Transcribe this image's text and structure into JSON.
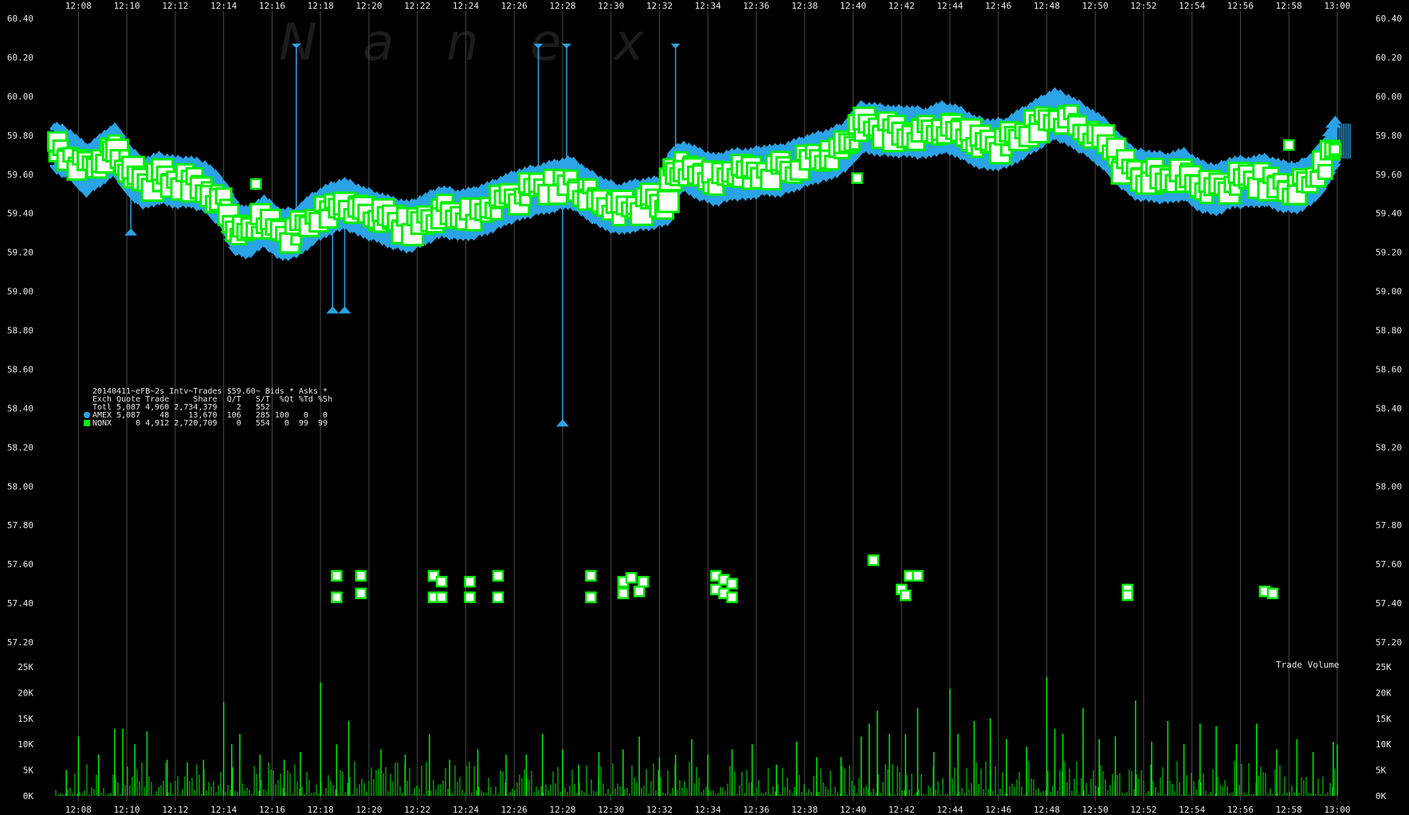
{
  "chart_data": {
    "type": "scatter",
    "title": "20140411~eFB~2s Intv~Trades $59.60~ Bids * Asks *",
    "watermark": [
      "N",
      "a",
      "n",
      "e",
      "x"
    ],
    "x_ticks": [
      "12:08",
      "12:10",
      "12:12",
      "12:14",
      "12:16",
      "12:18",
      "12:20",
      "12:22",
      "12:24",
      "12:26",
      "12:28",
      "12:30",
      "12:32",
      "12:34",
      "12:36",
      "12:38",
      "12:40",
      "12:42",
      "12:44",
      "12:46",
      "12:48",
      "12:50",
      "12:52",
      "12:54",
      "12:56",
      "12:58",
      "13:00"
    ],
    "xlim": [
      "12:07",
      "13:00"
    ],
    "price_axis": {
      "ticks": [
        "57.20",
        "57.40",
        "57.60",
        "57.80",
        "58.00",
        "58.20",
        "58.40",
        "58.60",
        "58.80",
        "59.00",
        "59.20",
        "59.40",
        "59.60",
        "59.80",
        "60.00",
        "60.20",
        "60.40"
      ],
      "ylim": [
        57.2,
        60.4
      ]
    },
    "volume_axis": {
      "label": "Trade Volume",
      "ticks": [
        "0K",
        "5K",
        "10K",
        "15K",
        "20K",
        "25K"
      ],
      "ylim": [
        0,
        25000
      ]
    },
    "grid": true,
    "legend": {
      "placement": "left-middle",
      "header": "Exch Quote Trade     Share  Q/T   S/T  %Qt %Td %Sh",
      "total": "Totl 5,087 4,960 2,734,379    2   552",
      "rows": [
        {
          "marker": "circle",
          "color": "#2aa4e6",
          "text": "AMEX 5,087    48    13,670  106   285 100   0   0"
        },
        {
          "marker": "square",
          "color": "#00ee00",
          "text": "NQNX     0 4,912 2,720,709    0   554   0  99  99"
        }
      ]
    },
    "series": [
      {
        "name": "AMEX",
        "color": "#2aa4e6",
        "quote_band": {
          "x": [
            "12:07:00",
            "12:07:40",
            "12:08:20",
            "12:09:00",
            "12:09:30",
            "12:10:00",
            "12:10:40",
            "12:11:20",
            "12:12:00",
            "12:12:40",
            "12:13:20",
            "12:14:00",
            "12:14:30",
            "12:15:00",
            "12:15:40",
            "12:16:20",
            "12:17:00",
            "12:17:40",
            "12:18:20",
            "12:19:00",
            "12:19:40",
            "12:20:20",
            "12:21:00",
            "12:21:40",
            "12:22:20",
            "12:23:00",
            "12:23:40",
            "12:24:20",
            "12:25:00",
            "12:25:40",
            "12:26:20",
            "12:27:00",
            "12:27:40",
            "12:28:20",
            "12:29:00",
            "12:29:40",
            "12:30:20",
            "12:31:00",
            "12:31:40",
            "12:32:20",
            "12:32:30",
            "12:33:00",
            "12:33:40",
            "12:34:20",
            "12:35:00",
            "12:35:40",
            "12:36:20",
            "12:37:00",
            "12:37:40",
            "12:38:20",
            "12:39:00",
            "12:39:40",
            "12:40:20",
            "12:41:00",
            "12:41:40",
            "12:42:20",
            "12:43:00",
            "12:43:40",
            "12:44:20",
            "12:45:00",
            "12:45:40",
            "12:46:20",
            "12:47:00",
            "12:47:40",
            "12:48:20",
            "12:49:00",
            "12:49:40",
            "12:50:20",
            "12:51:00",
            "12:51:40",
            "12:52:20",
            "12:53:00",
            "12:53:40",
            "12:54:20",
            "12:55:00",
            "12:55:40",
            "12:56:20",
            "12:57:00",
            "12:57:40",
            "12:58:20",
            "12:59:00",
            "12:59:30",
            "13:00:00"
          ],
          "mid": [
            59.74,
            59.7,
            59.62,
            59.68,
            59.73,
            59.63,
            59.55,
            59.58,
            59.56,
            59.56,
            59.53,
            59.44,
            59.32,
            59.3,
            59.36,
            59.29,
            59.3,
            59.37,
            59.42,
            59.45,
            59.41,
            59.38,
            59.35,
            59.33,
            59.37,
            59.41,
            59.39,
            59.4,
            59.43,
            59.47,
            59.5,
            59.52,
            59.54,
            59.56,
            59.5,
            59.45,
            59.42,
            59.44,
            59.45,
            59.47,
            59.6,
            59.64,
            59.6,
            59.57,
            59.6,
            59.6,
            59.62,
            59.62,
            59.65,
            59.68,
            59.7,
            59.74,
            59.84,
            59.83,
            59.82,
            59.82,
            59.81,
            59.84,
            59.82,
            59.77,
            59.75,
            59.76,
            59.81,
            59.86,
            59.91,
            59.87,
            59.82,
            59.76,
            59.67,
            59.6,
            59.59,
            59.58,
            59.6,
            59.54,
            59.52,
            59.56,
            59.56,
            59.57,
            59.54,
            59.53,
            59.58,
            59.66,
            59.79
          ],
          "half_width": 0.1
        },
        "spikes": [
          {
            "x": "12:17:00",
            "from": 59.42,
            "to": 60.27
          },
          {
            "x": "12:10:10",
            "from": 59.48,
            "to": 59.29
          },
          {
            "x": "12:18:30",
            "from": 59.36,
            "to": 58.89
          },
          {
            "x": "12:19:00",
            "from": 59.36,
            "to": 58.89
          },
          {
            "x": "12:27:00",
            "from": 59.62,
            "to": 60.27
          },
          {
            "x": "12:28:10",
            "from": 59.68,
            "to": 60.27
          },
          {
            "x": "12:28:00",
            "from": 59.5,
            "to": 58.31
          },
          {
            "x": "12:32:40",
            "from": 59.7,
            "to": 60.27
          }
        ]
      },
      {
        "name": "NQNX",
        "color": "#00ee00",
        "outliers": [
          {
            "x": "12:18:40",
            "y": 57.54
          },
          {
            "x": "12:18:40",
            "y": 57.43
          },
          {
            "x": "12:19:40",
            "y": 57.54
          },
          {
            "x": "12:19:40",
            "y": 57.45
          },
          {
            "x": "12:22:40",
            "y": 57.54
          },
          {
            "x": "12:23:00",
            "y": 57.51
          },
          {
            "x": "12:22:40",
            "y": 57.43
          },
          {
            "x": "12:23:00",
            "y": 57.43
          },
          {
            "x": "12:24:10",
            "y": 57.51
          },
          {
            "x": "12:24:10",
            "y": 57.43
          },
          {
            "x": "12:25:20",
            "y": 57.54
          },
          {
            "x": "12:25:20",
            "y": 57.43
          },
          {
            "x": "12:29:10",
            "y": 57.54
          },
          {
            "x": "12:29:10",
            "y": 57.43
          },
          {
            "x": "12:30:30",
            "y": 57.51
          },
          {
            "x": "12:30:50",
            "y": 57.53
          },
          {
            "x": "12:31:20",
            "y": 57.51
          },
          {
            "x": "12:30:30",
            "y": 57.45
          },
          {
            "x": "12:31:10",
            "y": 57.46
          },
          {
            "x": "12:34:20",
            "y": 57.54
          },
          {
            "x": "12:34:40",
            "y": 57.52
          },
          {
            "x": "12:35:00",
            "y": 57.5
          },
          {
            "x": "12:34:20",
            "y": 57.47
          },
          {
            "x": "12:34:40",
            "y": 57.45
          },
          {
            "x": "12:35:00",
            "y": 57.43
          },
          {
            "x": "12:40:50",
            "y": 57.62
          },
          {
            "x": "12:42:20",
            "y": 57.54
          },
          {
            "x": "12:42:40",
            "y": 57.54
          },
          {
            "x": "12:42:00",
            "y": 57.47
          },
          {
            "x": "12:42:10",
            "y": 57.44
          },
          {
            "x": "12:51:20",
            "y": 57.47
          },
          {
            "x": "12:51:20",
            "y": 57.44
          },
          {
            "x": "12:57:00",
            "y": 57.46
          },
          {
            "x": "12:57:20",
            "y": 57.45
          }
        ],
        "isolated": [
          {
            "x": "12:15:20",
            "y": 59.55
          },
          {
            "x": "12:40:10",
            "y": 59.58
          },
          {
            "x": "12:58:00",
            "y": 59.75
          }
        ]
      }
    ],
    "volume_series": {
      "name": "Trade Volume",
      "color": "#00ee00",
      "x": [
        "12:07:30",
        "12:08:00",
        "12:08:50",
        "12:09:30",
        "12:09:50",
        "12:10:20",
        "12:10:50",
        "12:11:40",
        "12:12:30",
        "12:13:10",
        "12:14:00",
        "12:14:20",
        "12:14:40",
        "12:15:30",
        "12:16:30",
        "12:17:10",
        "12:18:00",
        "12:18:40",
        "12:19:10",
        "12:20:30",
        "12:21:30",
        "12:22:30",
        "12:23:20",
        "12:24:30",
        "12:25:40",
        "12:26:30",
        "12:27:10",
        "12:28:00",
        "12:28:40",
        "12:29:30",
        "12:30:30",
        "12:31:10",
        "12:32:00",
        "12:32:40",
        "12:33:20",
        "12:34:00",
        "12:35:00",
        "12:35:50",
        "12:36:50",
        "12:37:40",
        "12:38:30",
        "12:39:30",
        "12:40:20",
        "12:40:40",
        "12:41:00",
        "12:41:30",
        "12:42:10",
        "12:42:40",
        "12:43:20",
        "12:44:00",
        "12:44:20",
        "12:45:00",
        "12:45:40",
        "12:46:20",
        "12:47:10",
        "12:48:00",
        "12:48:20",
        "12:48:40",
        "12:49:30",
        "12:50:10",
        "12:50:50",
        "12:51:40",
        "12:52:20",
        "12:53:00",
        "12:53:40",
        "12:54:20",
        "12:55:00",
        "12:55:50",
        "12:56:40",
        "12:57:30",
        "12:58:20",
        "12:59:00",
        "12:59:50",
        "13:00:00"
      ],
      "values": [
        5000,
        11500,
        8000,
        13000,
        13000,
        10000,
        12500,
        7000,
        6500,
        7000,
        18200,
        10000,
        12000,
        8000,
        7000,
        8500,
        22000,
        10000,
        14500,
        9000,
        8000,
        12000,
        7000,
        9000,
        8000,
        8000,
        12000,
        9000,
        6000,
        8500,
        9000,
        11500,
        7500,
        8000,
        11000,
        8000,
        9000,
        10000,
        6000,
        10500,
        7500,
        7500,
        11500,
        14000,
        16500,
        12000,
        12000,
        17000,
        8500,
        20800,
        12000,
        14500,
        15000,
        11000,
        9500,
        23000,
        13000,
        12000,
        17000,
        11000,
        11500,
        18500,
        10500,
        14500,
        10000,
        14000,
        13500,
        10000,
        14000,
        9000,
        11000,
        8500,
        10500,
        10000
      ]
    }
  }
}
